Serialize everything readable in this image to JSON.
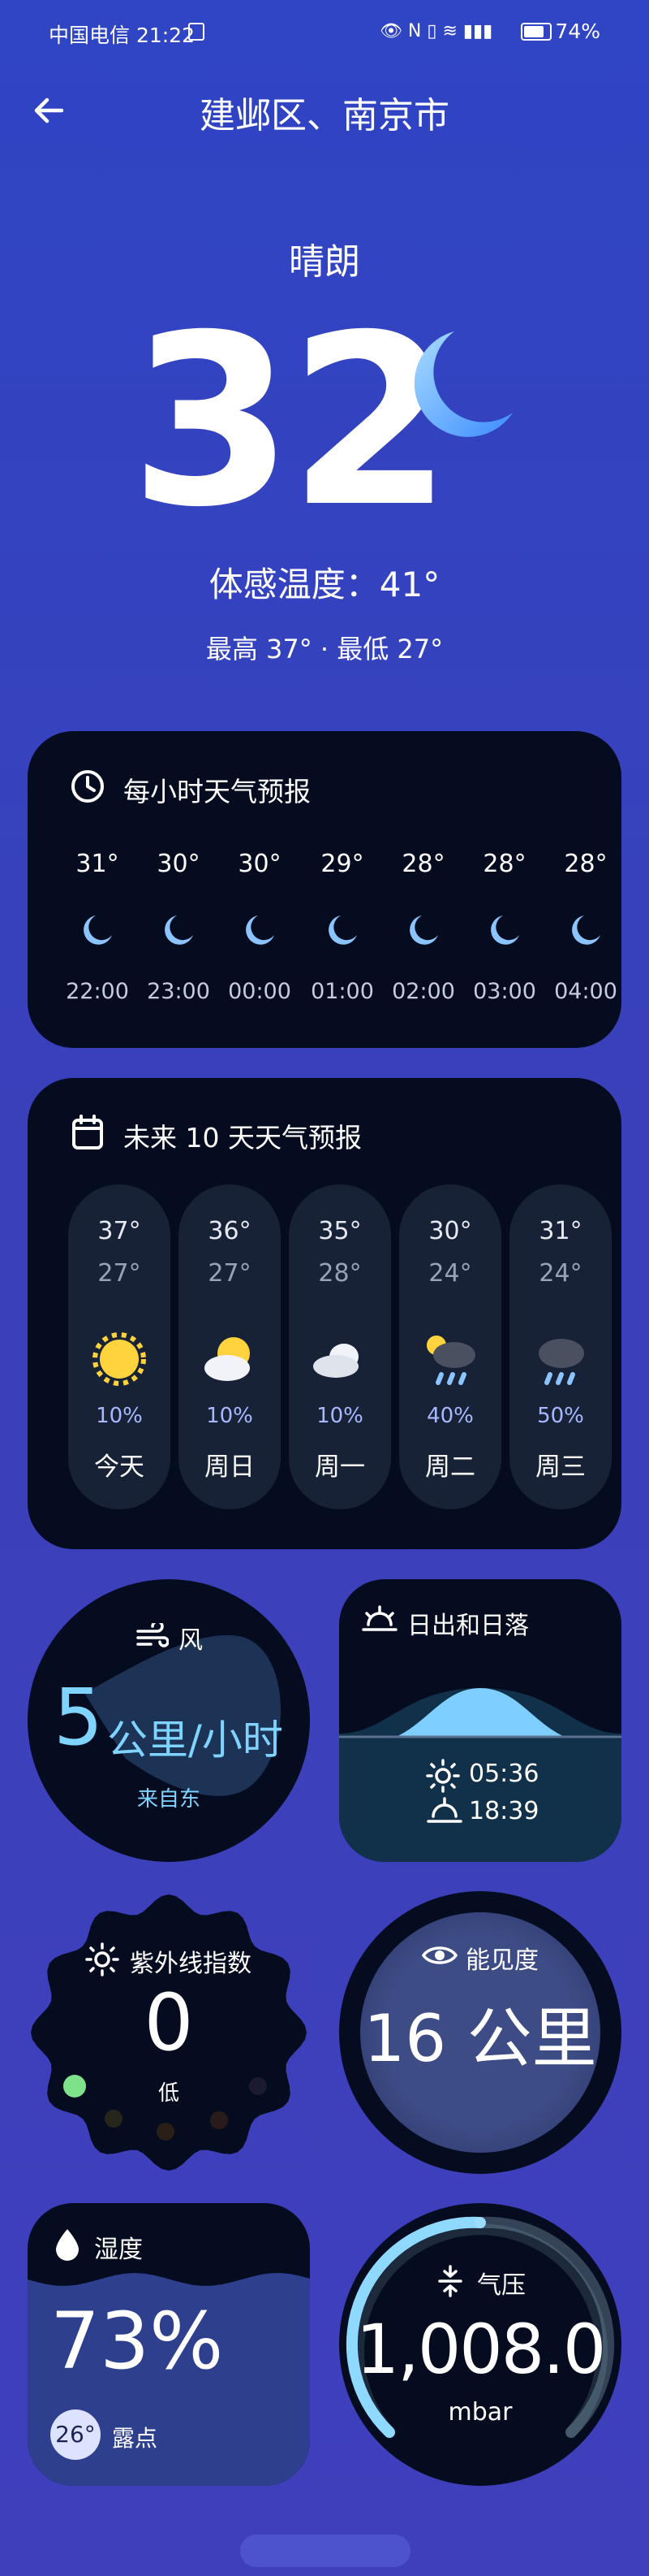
{
  "status": {
    "carrier_time": "中国电信 21:22",
    "battery": "74%"
  },
  "header": {
    "title": "建邺区、南京市"
  },
  "current": {
    "condition": "晴朗",
    "temperature": "32",
    "feels_like": "体感温度：41°",
    "hi_lo": "最高 37° · 最低 27°"
  },
  "hourly": {
    "title": "每小时天气预报",
    "items": [
      {
        "temp": "31°",
        "time": "22:00"
      },
      {
        "temp": "30°",
        "time": "23:00"
      },
      {
        "temp": "30°",
        "time": "00:00"
      },
      {
        "temp": "29°",
        "time": "01:00"
      },
      {
        "temp": "28°",
        "time": "02:00"
      },
      {
        "temp": "28°",
        "time": "03:00"
      },
      {
        "temp": "28°",
        "time": "04:00"
      }
    ],
    "icon": "moon-icon"
  },
  "daily": {
    "title": "未来 10 天天气预报",
    "items": [
      {
        "hi": "37°",
        "lo": "27°",
        "precip": "10%",
        "day": "今天",
        "icon": "sun-icon"
      },
      {
        "hi": "36°",
        "lo": "27°",
        "precip": "10%",
        "day": "周日",
        "icon": "partly-cloudy-icon"
      },
      {
        "hi": "35°",
        "lo": "28°",
        "precip": "10%",
        "day": "周一",
        "icon": "cloud-icon"
      },
      {
        "hi": "30°",
        "lo": "24°",
        "precip": "40%",
        "day": "周二",
        "icon": "sun-rain-icon"
      },
      {
        "hi": "31°",
        "lo": "24°",
        "precip": "50%",
        "day": "周三",
        "icon": "cloud-rain-icon"
      }
    ]
  },
  "wind": {
    "title": "风",
    "value": "5",
    "unit": "公里/小时",
    "direction": "来自东"
  },
  "sun": {
    "title": "日出和日落",
    "sunrise": "05:36",
    "sunset": "18:39"
  },
  "uv": {
    "title": "紫外线指数",
    "value": "0",
    "level": "低"
  },
  "visibility": {
    "title": "能见度",
    "value": "16 公里"
  },
  "humidity": {
    "title": "湿度",
    "value": "73%",
    "dew_value": "26°",
    "dew_label": "露点",
    "level": 0.73
  },
  "pressure": {
    "title": "气压",
    "value": "1,008.0",
    "unit": "mbar"
  },
  "colors": {
    "bg_top": "#2f45c4",
    "card": "#060c1f",
    "accent": "#7fd3ff"
  }
}
